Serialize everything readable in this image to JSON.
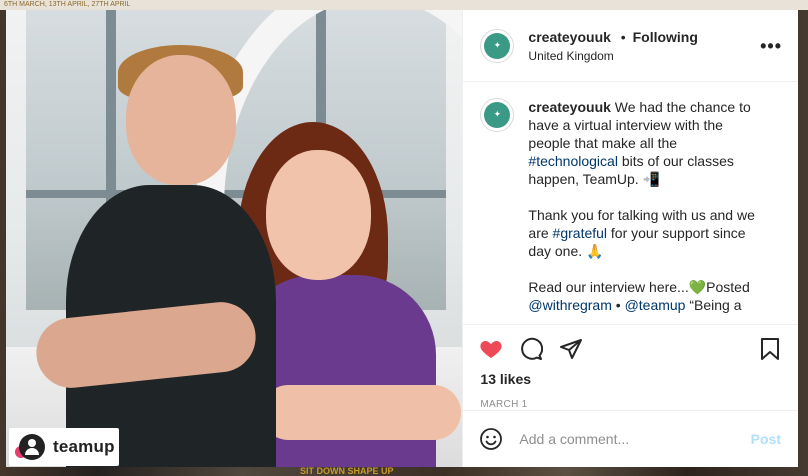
{
  "background": {
    "top_strip": "6TH MARCH, 13TH APRIL, 27TH APRIL",
    "bottom_strip": "SIT DOWN SHAPE UP"
  },
  "post": {
    "image_tag": {
      "label": "teamup"
    },
    "header": {
      "username": "createyouuk",
      "separator": "•",
      "follow_status": "Following",
      "location": "United Kingdom",
      "more": "•••"
    },
    "caption": {
      "username": "createyouuk",
      "text_a": " We had the chance to have a virtual interview with the people that make all the ",
      "hashtag_1": "#technological",
      "text_b": " bits of our classes happen, TeamUp. 📲",
      "para2_a": "Thank you for talking with us and we are ",
      "hashtag_2": "#grateful",
      "para2_b": " for your support since day one. 🙏",
      "para3_a": "Read our interview here...💚Posted ",
      "mention_1": "@withregram",
      "para3_sep": " • ",
      "mention_2": "@teamup",
      "para3_b": " “Being a"
    },
    "likes": "13 likes",
    "date": "MARCH 1",
    "comment": {
      "placeholder": "Add a comment...",
      "post_label": "Post"
    },
    "colors": {
      "like_red": "#ed4956",
      "link_blue": "#00376b",
      "post_disabled": "#b2dffc",
      "logo_green": "#3a9a85"
    },
    "icons": [
      "heart-icon",
      "comment-icon",
      "share-icon",
      "bookmark-icon",
      "emoji-icon",
      "more-icon"
    ]
  }
}
